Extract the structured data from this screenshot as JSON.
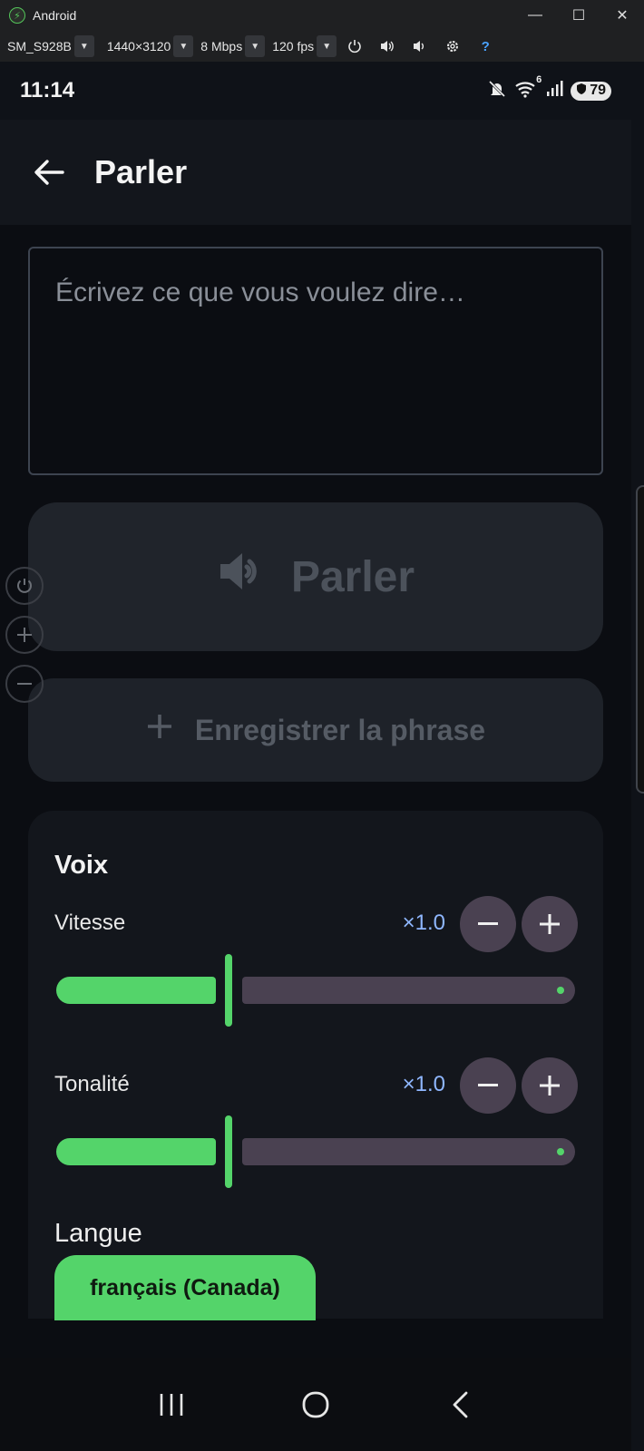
{
  "window": {
    "title": "Android",
    "minimize": "—",
    "maximize": "☐",
    "close": "✕"
  },
  "toolbar": {
    "device": "SM_S928B",
    "resolution": "1440×3120",
    "bitrate": "8 Mbps",
    "fps": "120 fps",
    "help": "?"
  },
  "status": {
    "time": "11:14",
    "wifi_sub": "6",
    "battery": "79"
  },
  "appbar": {
    "title": "Parler"
  },
  "input": {
    "value": "",
    "placeholder": "Écrivez ce que vous voulez dire…"
  },
  "speak_button": {
    "label": "Parler"
  },
  "save_button": {
    "label": "Enregistrer la phrase"
  },
  "voice": {
    "heading": "Voix",
    "speed": {
      "label": "Vitesse",
      "value": "×1.0",
      "level": 0.32
    },
    "pitch": {
      "label": "Tonalité",
      "value": "×1.0",
      "level": 0.32
    },
    "language": {
      "label": "Langue",
      "selected": "français (Canada)"
    }
  },
  "colors": {
    "accent": "#54d46a",
    "value_text": "#8fb7ff",
    "track": "#4a4151"
  }
}
